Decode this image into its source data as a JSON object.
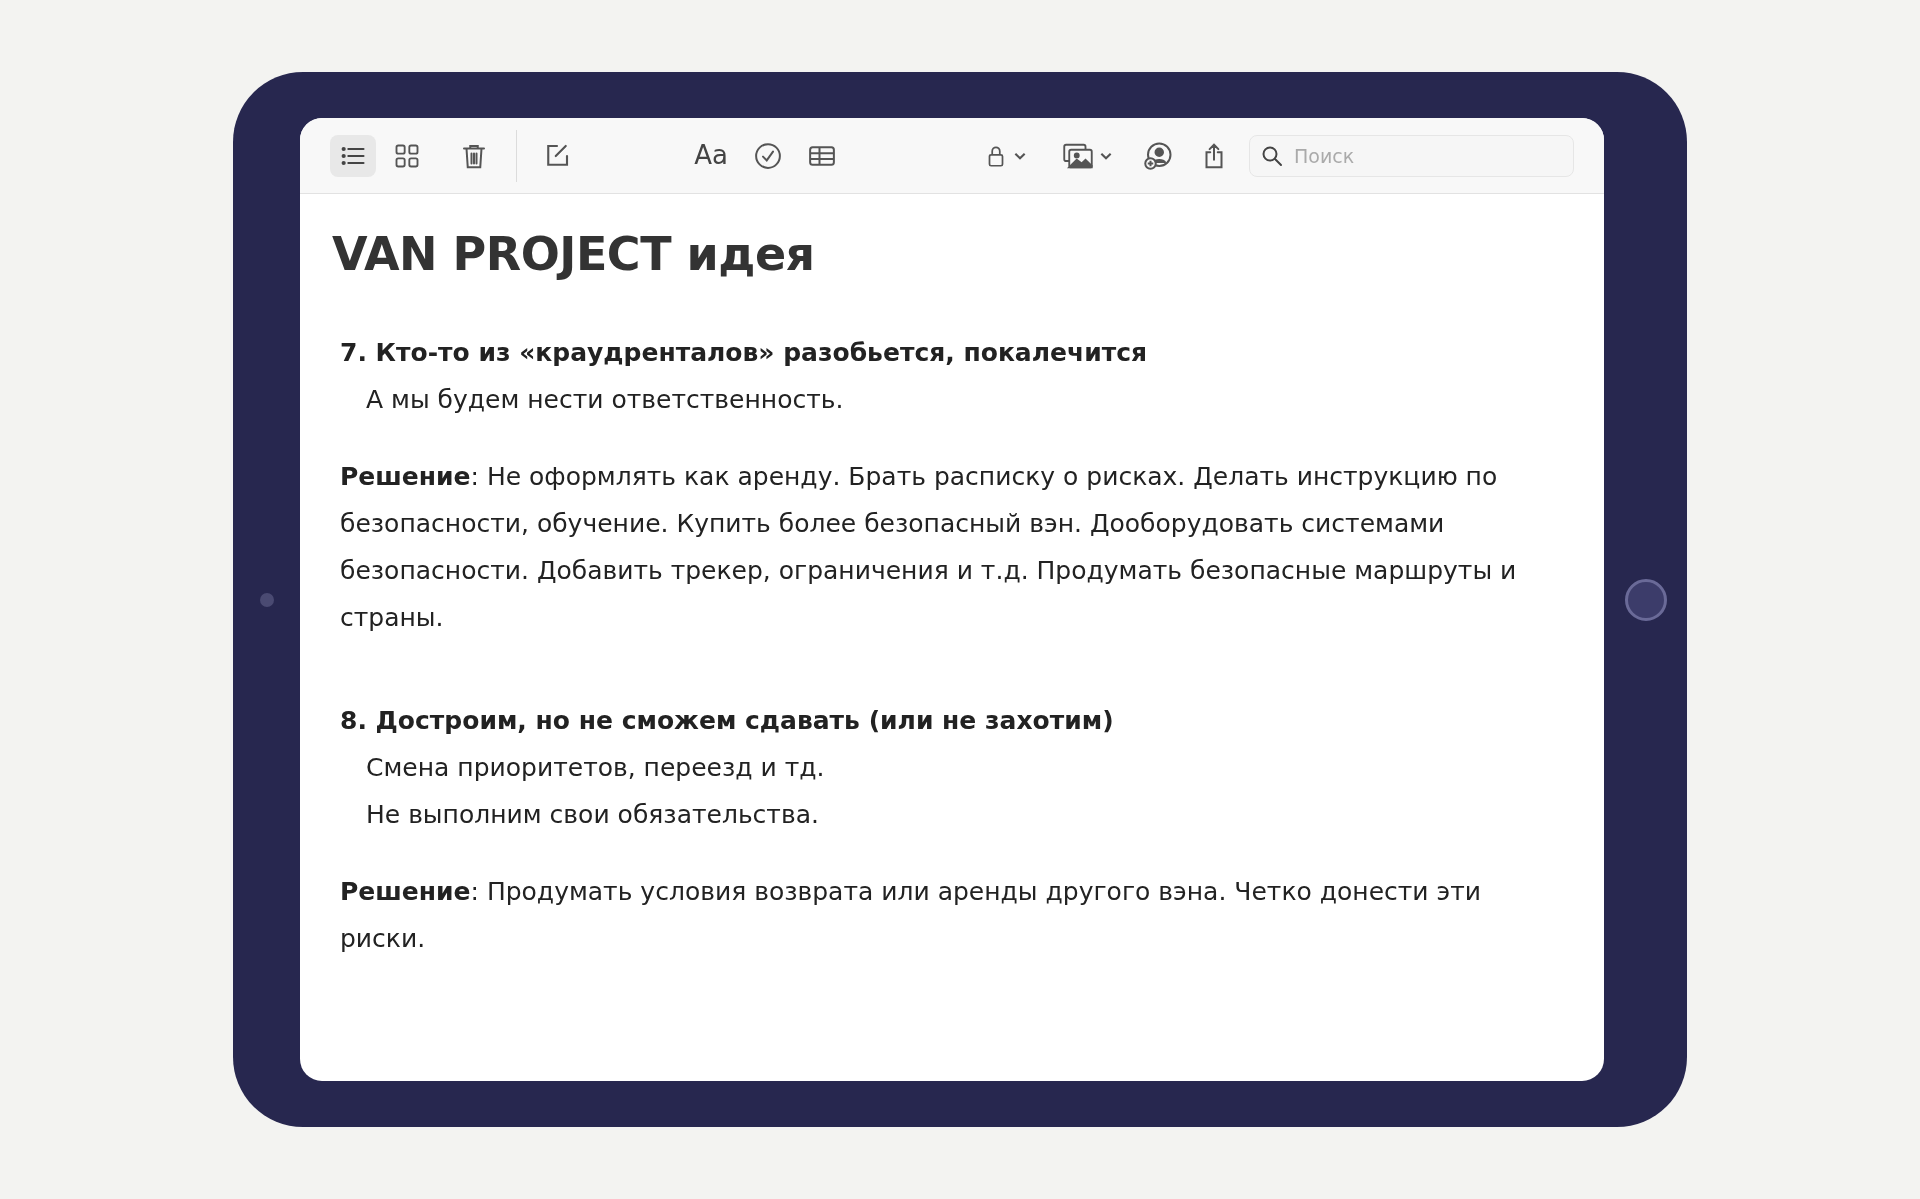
{
  "toolbar": {
    "view_modes": [
      {
        "kind": "list",
        "selected": true
      },
      {
        "kind": "gallery",
        "selected": false
      }
    ],
    "format_label": "Aa",
    "search": {
      "placeholder": "Поиск"
    }
  },
  "note": {
    "title": "VAN PROJECT идея",
    "sections": [
      {
        "heading": "7. Кто-то из «краудренталов» разобьется, покалечится",
        "lines": [
          "А мы будем нести ответственность."
        ],
        "solution": "**Решение**: Не оформлять как аренду. Брать расписку о рисках. Делать инструкцию по безопасности, обучение. Купить более безопасный вэн. Дооборудовать системами безопасности. Добавить трекер, ограничения и т.д. Продумать безопасные маршруты и страны."
      },
      {
        "heading": "8. Достроим, но не сможем сдавать (или не захотим)",
        "lines": [
          "Смена приоритетов, переезд и тд.",
          "Не выполним свои обязательства."
        ],
        "solution": "**Решение**: Продумать условия возврата или аренды другого вэна. Четко донести эти риски."
      }
    ]
  }
}
